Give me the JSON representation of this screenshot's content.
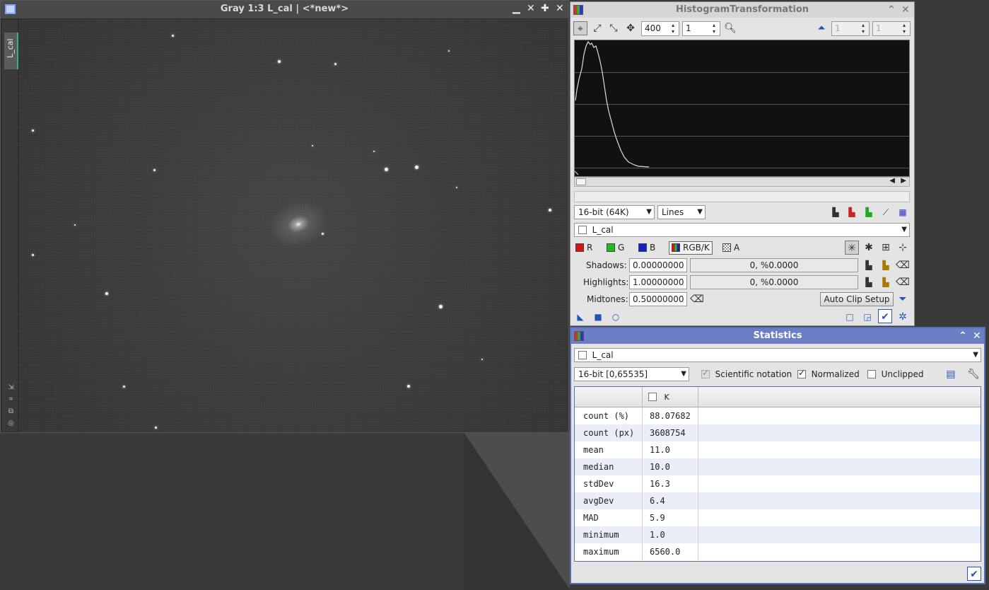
{
  "image_window": {
    "title": "Gray 1:3 L_cal | <*new*>",
    "side_tab_label": "L_cal",
    "buttons": [
      "‒",
      "✕",
      "✚",
      "✕"
    ]
  },
  "histogram_transformation": {
    "title": "HistogramTransformation",
    "zoom_h": "400",
    "zoom_v": "1",
    "right_spin_1": "1",
    "right_spin_2": "1",
    "resolution": "16-bit (64K)",
    "graph_style": "Lines",
    "view": "L_cal",
    "channels": {
      "r": "R",
      "g": "G",
      "b": "B",
      "rgbk": "RGB/K",
      "a": "A"
    },
    "shadows_label": "Shadows:",
    "shadows_value": "0.00000000",
    "shadows_clip": "0, %0.0000",
    "highlights_label": "Highlights:",
    "highlights_value": "1.00000000",
    "highlights_clip": "0, %0.0000",
    "midtones_label": "Midtones:",
    "midtones_value": "0.50000000",
    "auto_clip_label": "Auto Clip Setup"
  },
  "statistics": {
    "title": "Statistics",
    "view": "L_cal",
    "range": "16-bit [0,65535]",
    "scientific_label": "Scientific notation",
    "normalized_label": "Normalized",
    "unclipped_label": "Unclipped",
    "column_header": "K",
    "rows": [
      {
        "name": "count (%)",
        "value": "88.07682"
      },
      {
        "name": "count (px)",
        "value": "3608754"
      },
      {
        "name": "mean",
        "value": "11.0"
      },
      {
        "name": "median",
        "value": "10.0"
      },
      {
        "name": "stdDev",
        "value": "16.3"
      },
      {
        "name": "avgDev",
        "value": "6.4"
      },
      {
        "name": "MAD",
        "value": "5.9"
      },
      {
        "name": "minimum",
        "value": "1.0"
      },
      {
        "name": "maximum",
        "value": "6560.0"
      }
    ]
  },
  "colors": {
    "accent": "#6b7fc7",
    "red": "#dd1111",
    "green": "#22bb22",
    "blue": "#1122cc"
  }
}
